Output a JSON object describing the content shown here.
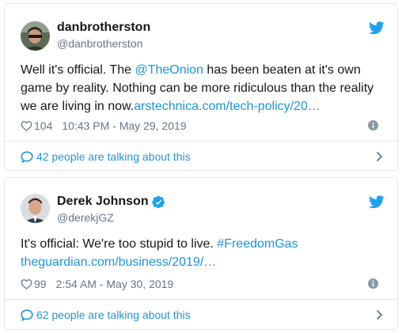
{
  "colors": {
    "link": "#1b95e0",
    "text": "#14171a",
    "muted": "#657786",
    "border": "#e1e8ed",
    "twitter_blue": "#1da1f2"
  },
  "tweets": [
    {
      "display_name": "danbrotherston",
      "handle": "@danbrotherston",
      "verified": false,
      "text_before_mention": "Well it's official. The ",
      "mention": "@TheOnion",
      "text_after_mention": " has been beaten at it's own game by reality.  Nothing can be more ridiculous than the reality we are living in now.",
      "link_text": "arstechnica.com/tech-policy/20…",
      "likes": "104",
      "timestamp": "10:43 PM - May 29, 2019",
      "talking": "42 people are talking about this",
      "icons": [
        "avatar",
        "twitter-bird-icon",
        "heart-icon",
        "info-icon",
        "speech-bubble-icon",
        "chevron-right-icon"
      ]
    },
    {
      "display_name": "Derek Johnson",
      "handle": "@derekjGZ",
      "verified": true,
      "text": "It's official: We're too stupid to live. ",
      "hashtag": "#FreedomGas",
      "link_text": "theguardian.com/business/2019/…",
      "likes": "99",
      "timestamp": "2:54 AM - May 30, 2019",
      "talking": "62 people are talking about this",
      "icons": [
        "avatar",
        "verified-badge-icon",
        "twitter-bird-icon",
        "heart-icon",
        "info-icon",
        "speech-bubble-icon",
        "chevron-right-icon"
      ]
    }
  ]
}
